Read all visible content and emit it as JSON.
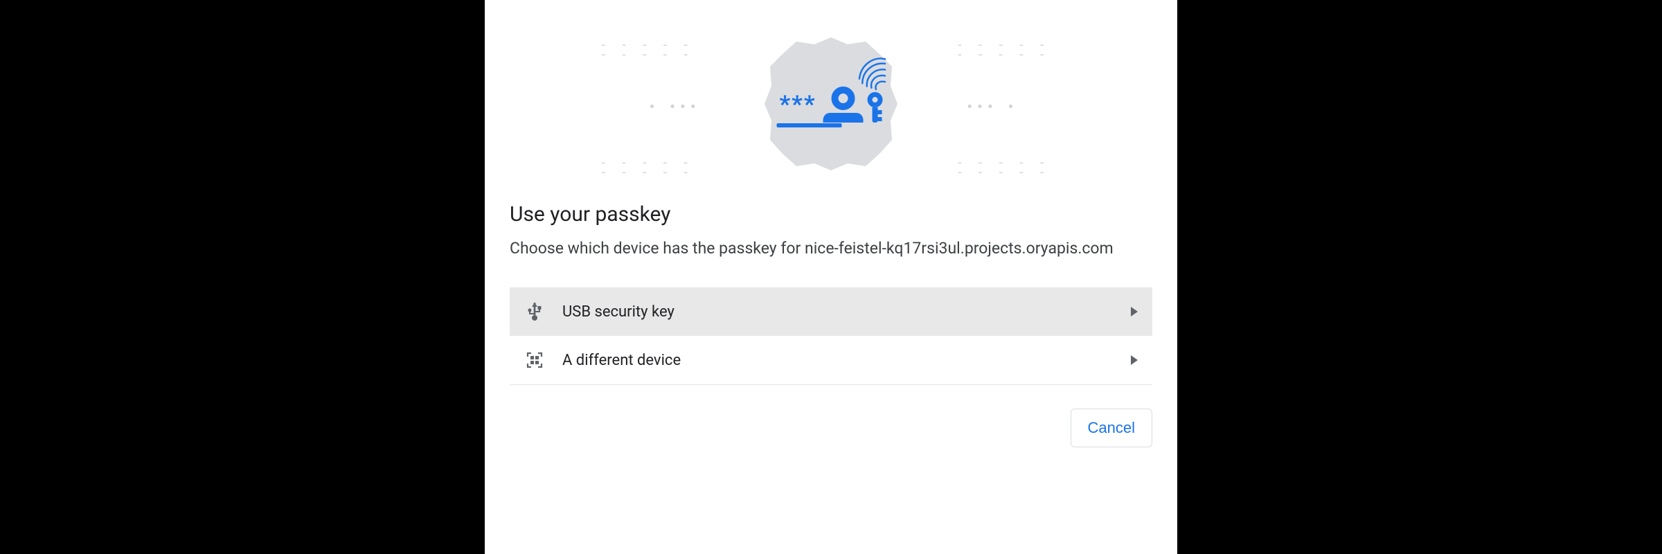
{
  "dialog": {
    "title": "Use your passkey",
    "description": "Choose which device has the passkey for nice-feistel-kq17rsi3ul.projects.oryapis.com",
    "options": [
      {
        "label": "USB security key",
        "selected": true
      },
      {
        "label": "A different device",
        "selected": false
      }
    ],
    "cancel_label": "Cancel"
  }
}
